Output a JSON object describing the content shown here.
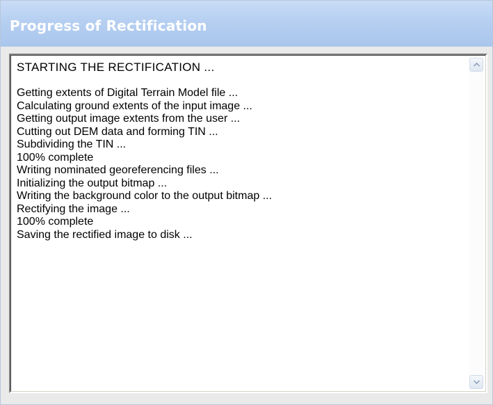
{
  "window": {
    "title": "Progress of Rectification"
  },
  "log": {
    "lines": [
      "STARTING THE RECTIFICATION ...",
      "",
      "Getting extents of Digital Terrain Model file ...",
      "Calculating ground extents of the input image ...",
      "Getting output image extents from the user ...",
      "Cutting out DEM data and forming TIN ...",
      "Subdividing the TIN ...",
      "100% complete",
      "Writing nominated georeferencing files ...",
      "Initializing the output bitmap ...",
      "Writing the background color to the output bitmap ...",
      "Rectifying the image ...",
      "100% complete",
      "Saving the rectified image to disk ..."
    ]
  },
  "scrollbar": {
    "up_icon": "scroll-up-arrow-icon",
    "down_icon": "scroll-down-arrow-icon"
  },
  "colors": {
    "header_gradient_top": "#c9dcf7",
    "header_gradient_bottom": "#a9c6ec",
    "title_text": "#ffffff",
    "panel_background": "#eaeaea",
    "log_background": "#ffffff"
  }
}
